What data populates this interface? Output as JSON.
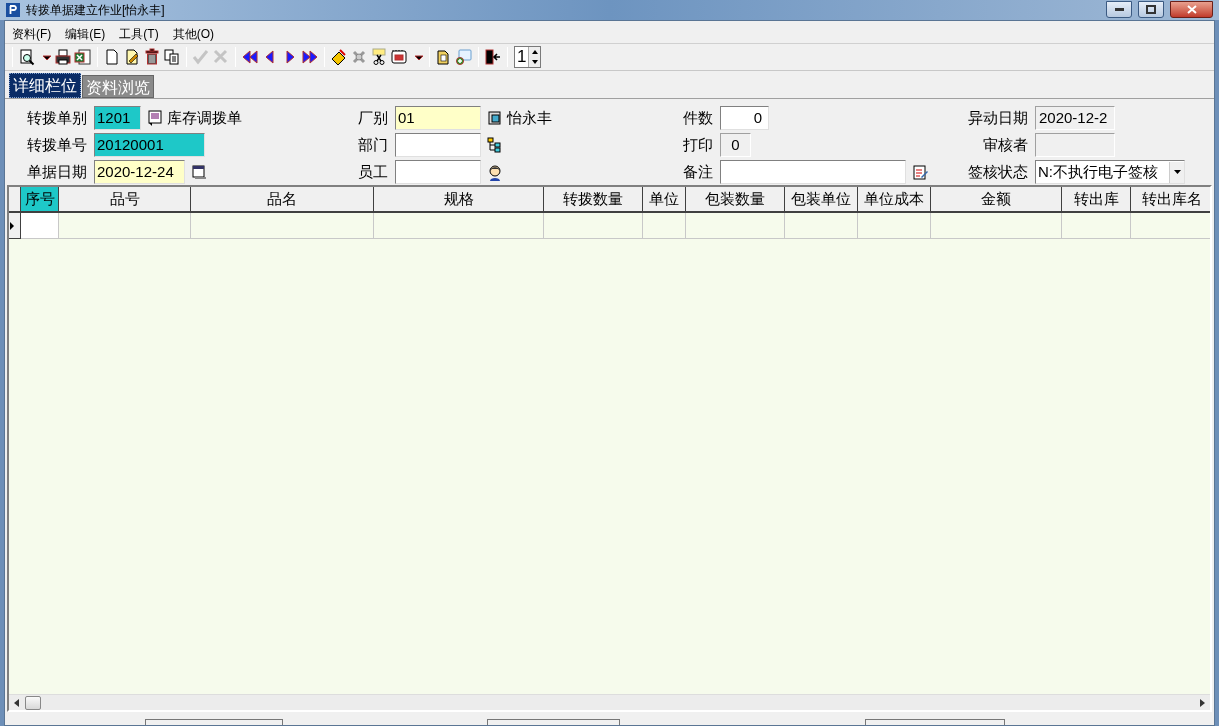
{
  "window": {
    "title": "转拨单据建立作业[怡永丰]"
  },
  "menu": [
    "资料(F)",
    "编辑(E)",
    "工具(T)",
    "其他(O)"
  ],
  "toolbar": [
    [
      {
        "kind": "preview",
        "disabled": false
      },
      {
        "kind": "caret",
        "disabled": false
      },
      {
        "kind": "print",
        "disabled": false
      },
      {
        "kind": "excel",
        "disabled": false
      }
    ],
    [
      {
        "kind": "new",
        "disabled": false
      },
      {
        "kind": "edit",
        "disabled": false
      },
      {
        "kind": "delete",
        "disabled": false
      },
      {
        "kind": "copy",
        "disabled": false
      }
    ],
    [
      {
        "kind": "confirm",
        "disabled": true
      },
      {
        "kind": "cancel",
        "disabled": true
      }
    ],
    [
      {
        "kind": "first",
        "disabled": false
      },
      {
        "kind": "prev",
        "disabled": false
      },
      {
        "kind": "next",
        "disabled": false
      },
      {
        "kind": "last",
        "disabled": false
      }
    ],
    [
      {
        "kind": "brush",
        "disabled": false
      },
      {
        "kind": "tools",
        "disabled": false
      },
      {
        "kind": "cut",
        "disabled": false
      },
      {
        "kind": "notebook",
        "disabled": false
      },
      {
        "kind": "caret",
        "disabled": false
      }
    ],
    [
      {
        "kind": "folder",
        "disabled": false
      },
      {
        "kind": "comment",
        "disabled": false
      }
    ],
    [
      {
        "kind": "exit",
        "disabled": false
      }
    ]
  ],
  "page_spinner": {
    "value": "1"
  },
  "tabs": [
    {
      "label": "详细栏位",
      "selected": true
    },
    {
      "label": "资料浏览",
      "selected": false
    }
  ],
  "form": [
    [
      {
        "label": "转拨单别",
        "value": "1201",
        "kind": "key",
        "note": "库存调拨单"
      },
      {
        "label": "转拨单号",
        "value": "20120001",
        "kind": "key"
      },
      {
        "label": "单据日期",
        "value": "2020-12-24",
        "kind": "required"
      }
    ],
    [
      {
        "label": "厂别",
        "value": "01",
        "kind": "required",
        "note": "怡永丰"
      },
      {
        "label": "部门",
        "kind": "input"
      },
      {
        "label": "员工",
        "kind": "input"
      }
    ],
    [
      {
        "label": "件数",
        "value": "0",
        "kind": "input"
      },
      {
        "label": "打印",
        "value": "0",
        "kind": "readonly"
      },
      {
        "label": "备注",
        "kind": "input"
      }
    ],
    [
      {
        "label": "异动日期",
        "value": "2020-12-2",
        "kind": "readonly"
      },
      {
        "label": "审核者",
        "kind": "readonly"
      },
      {
        "label": "签核状态",
        "value": "N:不执行电子签核",
        "kind": "dropdown"
      }
    ]
  ],
  "grid": {
    "columns": [
      {
        "label": "序号",
        "selected": true
      },
      {
        "label": "品号",
        "selected": false
      },
      {
        "label": "品名",
        "selected": false
      },
      {
        "label": "规格",
        "selected": false
      },
      {
        "label": "转拨数量",
        "selected": false
      },
      {
        "label": "单位",
        "selected": false
      },
      {
        "label": "包装数量",
        "selected": false
      },
      {
        "label": "包装单位",
        "selected": false
      },
      {
        "label": "单位成本",
        "selected": false
      },
      {
        "label": "金额",
        "selected": false
      },
      {
        "label": "转出库",
        "selected": false
      },
      {
        "label": "转出库名",
        "selected": false
      }
    ],
    "current_row": true
  }
}
